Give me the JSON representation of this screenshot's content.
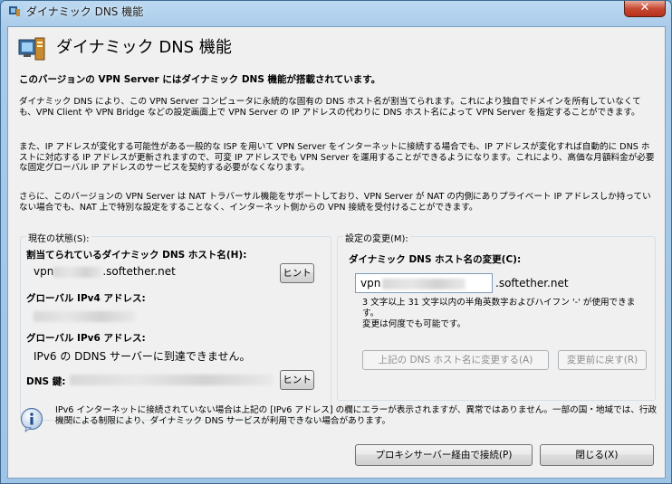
{
  "window": {
    "title": "ダイナミック DNS 機能",
    "close_label": "✕"
  },
  "header": {
    "title": "ダイナミック DNS  機能"
  },
  "intro": {
    "lead": "このバージョンの VPN Server にはダイナミック DNS 機能が搭載されています。",
    "para1": "ダイナミック DNS により、この VPN Server コンピュータに永続的な固有の DNS ホスト名が割当てられます。これにより独自でドメインを所有していなくても、VPN Client や VPN Bridge などの設定画面上で VPN Server の IP アドレスの代わりに DNS ホスト名によって VPN Server を指定することができます。",
    "para2": "また、IP アドレスが変化する可能性がある一般的な ISP を用いて VPN Server をインターネットに接続する場合でも、IP アドレスが変化すれば自動的に DNS ホストに対応する IP アドレスが更新されますので、可変 IP アドレスでも VPN Server を運用することができるようになります。これにより、高価な月額料金が必要な固定グローバル IP アドレスのサービスを契約する必要がなくなります。",
    "para3": "さらに、このバージョンの VPN Server は NAT トラバーサル機能をサポートしており、VPN Server が NAT の内側にありプライベート IP アドレスしか持っていない場合でも、NAT 上で特別な設定をすることなく、インターネット側からの VPN 接続を受付けることができます。"
  },
  "status": {
    "group_label": "現在の状態(S):",
    "hostname_label": "割当てられているダイナミック DNS ホスト名(H):",
    "hostname_prefix": "vpn",
    "hostname_suffix": ".softether.net",
    "hint_button": "ヒント",
    "ipv4_label": "グローバル IPv4 アドレス:",
    "ipv6_label": "グローバル IPv6 アドレス:",
    "ipv6_value": "IPv6 の DDNS サーバーに到達できません。",
    "dns_key_label": "DNS 鍵:",
    "dns_key_hint_button": "ヒント"
  },
  "change": {
    "group_label": "設定の変更(M):",
    "change_label": "ダイナミック DNS ホスト名の変更(C):",
    "input_value": "vpn",
    "input_suffix": ".softether.net",
    "hint_line1": "3 文字以上 31 文字以内の半角英数字およびハイフン '-' が使用できます。",
    "hint_line2": "変更は何度でも可能です。",
    "apply_button": "上記の DNS ホスト名に変更する(A)",
    "revert_button": "変更前に戻す(R)"
  },
  "info": {
    "text": "IPv6 インターネットに接続されていない場合は上記の [IPv6 アドレス] の欄にエラーが表示されますが、異常ではありません。一部の国・地域では、行政機関による制限により、ダイナミック DNS サービスが利用できない場合があります。"
  },
  "footer": {
    "proxy_button": "プロキシサーバー経由で接続(P)",
    "close_button": "閉じる(X)"
  }
}
